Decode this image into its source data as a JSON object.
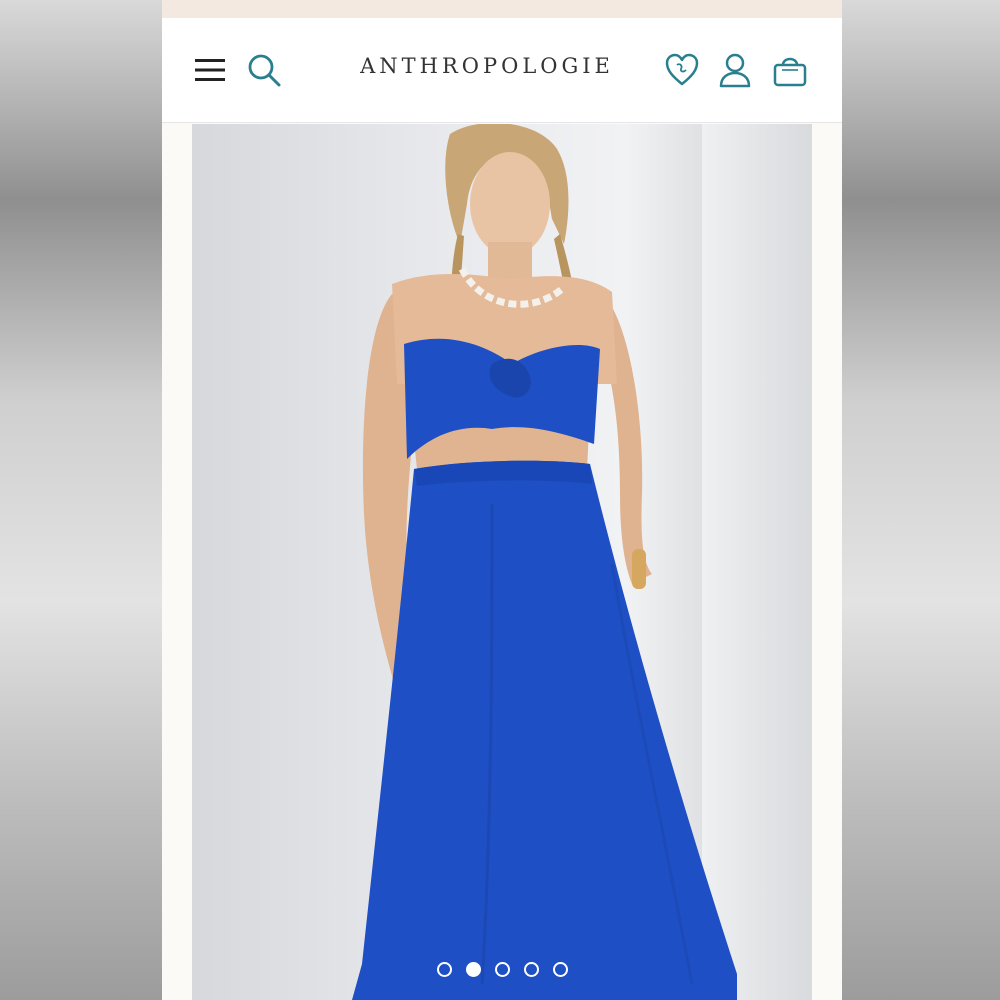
{
  "brand": {
    "logo_text": "ANTHROPOLOGIE"
  },
  "header": {
    "icons": [
      "menu-icon",
      "search-icon",
      "heart-icon",
      "account-icon",
      "bag-icon"
    ],
    "accent_color": "#2a7f8f"
  },
  "product_image": {
    "subject_colors": {
      "outfit": "#1f4fc4",
      "background": "#e6e7ea"
    }
  },
  "carousel": {
    "total_slides": 5,
    "active_index": 1
  }
}
